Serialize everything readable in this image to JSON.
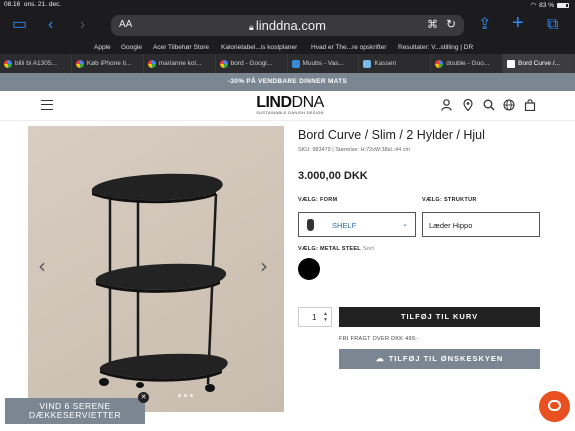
{
  "status_bar": {
    "time": "08.16",
    "date": "ons. 21. dec.",
    "wifi_battery": "83 %"
  },
  "browser": {
    "address_aa": "AA",
    "url": "linddna.com",
    "bookmarks": [
      "Apple",
      "Google",
      "Acer Tilbehør Store",
      "Kalorietabel...is kostplaner",
      "Hvad er The...re opskrifter",
      "Resultater: V...stilling | DR"
    ],
    "tabs": [
      {
        "label": "billi bi A1305...",
        "favicon": "google"
      },
      {
        "label": "Køb iPhone ti...",
        "favicon": "google"
      },
      {
        "label": "marianne kol...",
        "favicon": "google"
      },
      {
        "label": "bord - Googl...",
        "favicon": "google"
      },
      {
        "label": "Muubs - Vas...",
        "favicon": "muubs"
      },
      {
        "label": "Kassen",
        "favicon": "kassen"
      },
      {
        "label": "double - Goo...",
        "favicon": "google"
      },
      {
        "label": "Bord Curve /...",
        "favicon": "linddna",
        "active": true
      }
    ]
  },
  "site": {
    "promo_banner": "-30% PÅ VENDBARE DINNER MATS",
    "logo_main": "LIND",
    "logo_main_2": "DNA",
    "logo_sub": "SUSTAINABLE DANISH DESIGN"
  },
  "product": {
    "title": "Bord Curve / Slim / 2 Hylder / Hjul",
    "meta": "SKU: 983479  |  Størrelse: H:72xW:38xL:44 cm",
    "price": "3.000,00 DKK",
    "form_label": "VÆLG: FORM",
    "form_value": "SHELF",
    "structure_label": "VÆLG: STRUKTUR",
    "structure_value": "Læder Hippo",
    "metal_label": "VÆLG: METAL STEEL",
    "metal_value": "Sort",
    "quantity": "1",
    "add_to_cart": "TILFØJ TIL KURV",
    "free_shipping": "FRI FRAGT OVER DKK 499,-",
    "add_to_wishlist": "TILFØJ TIL ØNSKESKYEN"
  },
  "popup": {
    "line1": "VIND 6 SERENE",
    "line2": "DÆKKESERVIETTER"
  },
  "colors": {
    "accent_grey": "#7a8691",
    "chat_orange": "#e8501f",
    "link_blue": "#2b6ca8"
  }
}
